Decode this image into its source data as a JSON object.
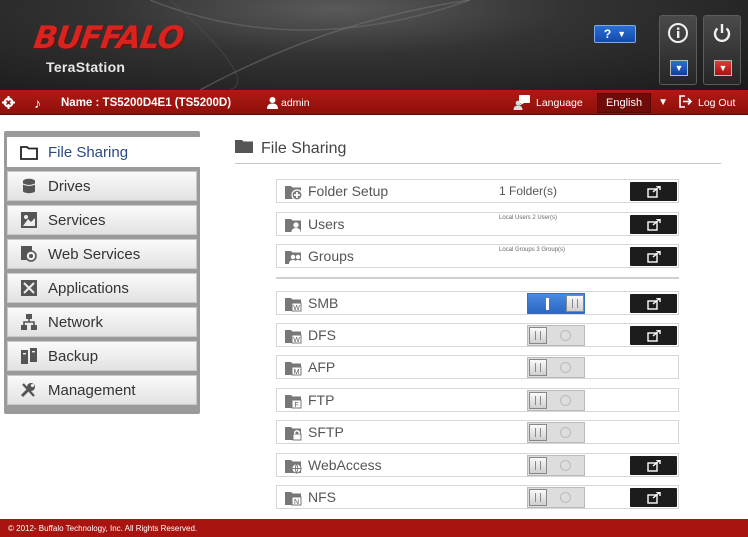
{
  "header": {
    "logo": "BUFFALO",
    "product": "TeraStation",
    "help_label": "?"
  },
  "topbar": {
    "name_label": "Name : TS5200D4E1 (TS5200D)",
    "user": "admin",
    "language_label": "Language",
    "language_value": "English",
    "logout_label": "Log Out"
  },
  "sidebar": {
    "items": [
      {
        "label": "File Sharing",
        "icon": "folder-icon"
      },
      {
        "label": "Drives",
        "icon": "drive-icon"
      },
      {
        "label": "Services",
        "icon": "services-icon"
      },
      {
        "label": "Web Services",
        "icon": "web-services-icon"
      },
      {
        "label": "Applications",
        "icon": "applications-icon"
      },
      {
        "label": "Network",
        "icon": "network-icon"
      },
      {
        "label": "Backup",
        "icon": "backup-icon"
      },
      {
        "label": "Management",
        "icon": "wrench-icon"
      }
    ]
  },
  "main": {
    "title": "File Sharing",
    "rows": [
      {
        "label": "Folder Setup",
        "value": "1 Folder(s)"
      },
      {
        "label": "Users",
        "value": "Local Users 2 User(s)"
      },
      {
        "label": "Groups",
        "value": "Local Groups 3 Group(s)"
      }
    ],
    "services": [
      {
        "label": "SMB",
        "state": "on"
      },
      {
        "label": "DFS",
        "state": "off"
      },
      {
        "label": "AFP",
        "state": "off"
      },
      {
        "label": "FTP",
        "state": "off"
      },
      {
        "label": "SFTP",
        "state": "off"
      },
      {
        "label": "WebAccess",
        "state": "off"
      },
      {
        "label": "NFS",
        "state": "off"
      }
    ]
  },
  "footer": {
    "copyright": "© 2012- Buffalo Technology, Inc. All Rights Reserved."
  },
  "colors": {
    "brand_red": "#d8231f",
    "topbar_red": "#a01510",
    "toggle_on": "#3a7ad8",
    "sidebar_active_text": "#2b4a80"
  }
}
